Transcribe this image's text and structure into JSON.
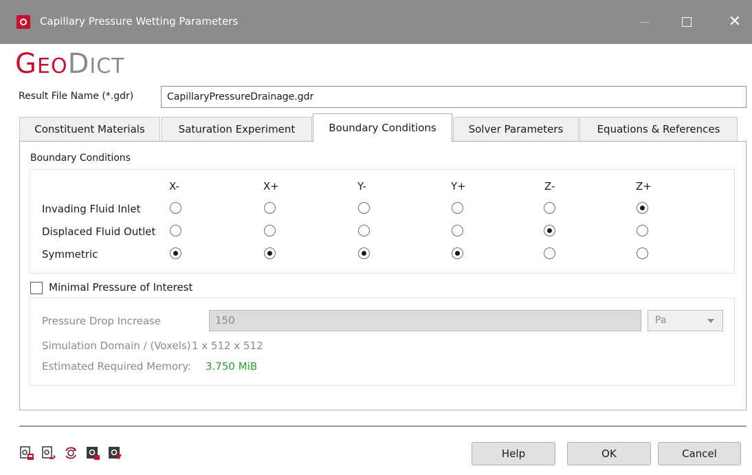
{
  "window": {
    "title": "Capillary Pressure Wetting Parameters",
    "close_glyph": "✕"
  },
  "logo": {
    "part1_big": "G",
    "part1_small": "EO",
    "part2_big": "D",
    "part2_small": "ICT"
  },
  "result_file": {
    "label": "Result File Name (*.gdr)",
    "value": "CapillaryPressureDrainage.gdr"
  },
  "tabs": [
    {
      "label": "Constituent Materials",
      "active": false
    },
    {
      "label": "Saturation Experiment",
      "active": false
    },
    {
      "label": "Boundary Conditions",
      "active": true
    },
    {
      "label": "Solver Parameters",
      "active": false
    },
    {
      "label": "Equations & References",
      "active": false
    }
  ],
  "boundary_conditions": {
    "group_title": "Boundary Conditions",
    "columns": [
      "X-",
      "X+",
      "Y-",
      "Y+",
      "Z-",
      "Z+"
    ],
    "rows": [
      {
        "label": "Invading Fluid Inlet",
        "selected": "Z+"
      },
      {
        "label": "Displaced Fluid Outlet",
        "selected": "Z-"
      },
      {
        "label": "Symmetric",
        "selected": [
          "X-",
          "X+",
          "Y-",
          "Y+"
        ]
      }
    ]
  },
  "minimal_pressure": {
    "checkbox_label": "Minimal Pressure of Interest",
    "checked": false,
    "pressure_drop_label": "Pressure Drop Increase",
    "pressure_drop_value": "150",
    "unit": "Pa",
    "domain_label": "Simulation Domain / (Voxels)",
    "domain_value": "1 x 512 x 512",
    "memory_label": "Estimated Required Memory:",
    "memory_value": "3.750 MiB",
    "memory_color": "#2a9d2a"
  },
  "toolbar_icons": [
    "load-settings-icon",
    "save-settings-icon",
    "reset-settings-icon",
    "import-settings-icon",
    "export-settings-icon"
  ],
  "buttons": {
    "help": "Help",
    "ok": "OK",
    "cancel": "Cancel"
  },
  "colors": {
    "brand_red": "#c8102e",
    "titlebar": "#8c8c8c"
  }
}
